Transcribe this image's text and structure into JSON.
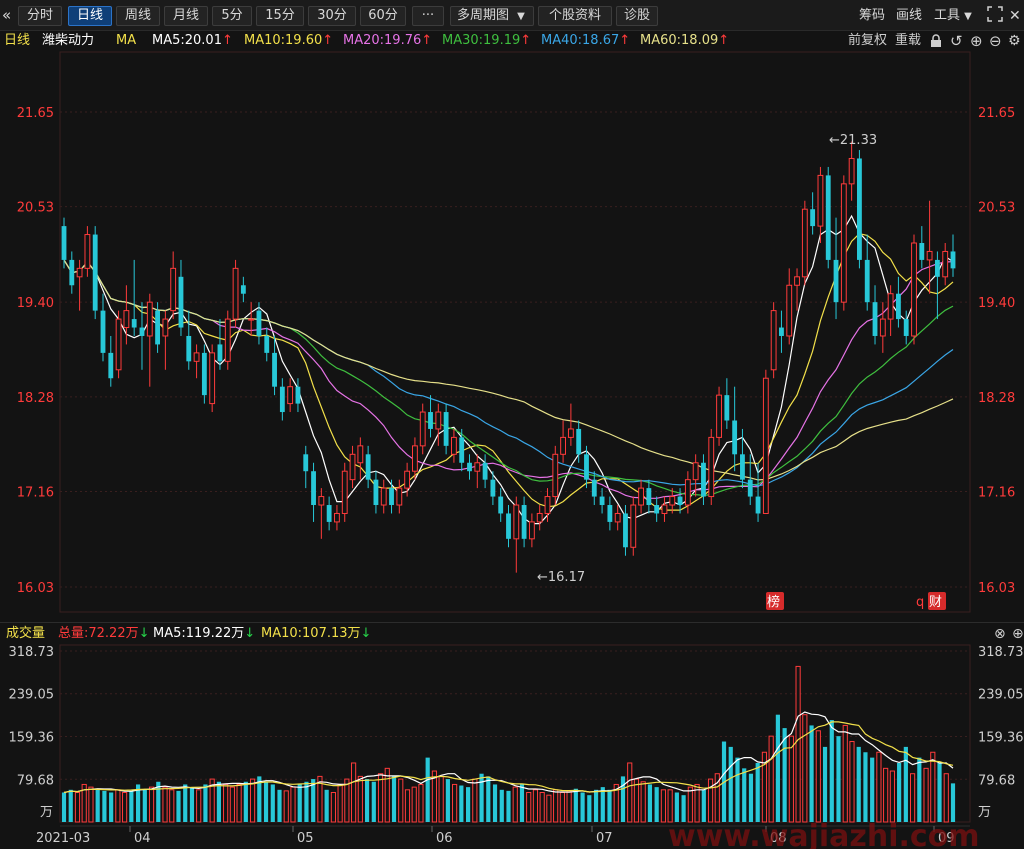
{
  "toolbar": {
    "back_icon": "double-chevron-left-icon",
    "buttons": [
      "分时",
      "日线",
      "周线",
      "月线",
      "5分",
      "15分",
      "30分",
      "60分",
      "···",
      "多周期图",
      "个股资料",
      "诊股"
    ],
    "active": "日线",
    "multi_period_caret": "▼",
    "right_items": [
      "筹码",
      "画线",
      "工具"
    ],
    "tools_caret": "▼",
    "fullscreen_icon": "fullscreen-icon",
    "close_icon": "close-icon"
  },
  "ma_bar": {
    "period": "日线",
    "stock": "潍柴动力",
    "ma_label": "MA",
    "items": [
      {
        "text": "MA5:20.01",
        "arrow": "↑",
        "color": "#ffffff"
      },
      {
        "text": "MA10:19.60",
        "arrow": "↑",
        "color": "#f2e04a"
      },
      {
        "text": "MA20:19.76",
        "arrow": "↑",
        "color": "#e673e6"
      },
      {
        "text": "MA30:19.19",
        "arrow": "↑",
        "color": "#3fbf3f"
      },
      {
        "text": "MA40:18.67",
        "arrow": "↑",
        "color": "#3aa6e6"
      },
      {
        "text": "MA60:18.09",
        "arrow": "↑",
        "color": "#e6e08a"
      }
    ],
    "right": {
      "adjust": "前复权",
      "reset": "重载"
    },
    "icons": [
      "lock-icon",
      "undo-icon",
      "zoom-in-icon",
      "zoom-out-icon",
      "settings-icon"
    ]
  },
  "price_axis": {
    "ticks": [
      "21.65",
      "20.53",
      "19.40",
      "18.28",
      "17.16",
      "16.03"
    ],
    "high_annotation": "←21.33",
    "low_annotation": "←16.17",
    "badges": [
      "榜",
      "财"
    ],
    "marker": "q"
  },
  "volume_bar": {
    "title": "成交量",
    "total": "总量:72.22万",
    "total_arrow": "↓",
    "ma5": "MA5:119.22万",
    "ma5_arrow": "↓",
    "ma10": "MA10:107.13万",
    "ma10_arrow": "↓",
    "icons": [
      "close-circle-icon",
      "add-circle-icon"
    ]
  },
  "volume_axis": {
    "ticks": [
      "318.73",
      "239.05",
      "159.36",
      "79.68"
    ],
    "unit": "万"
  },
  "date_axis": [
    "2021-03",
    "04",
    "05",
    "06",
    "07",
    "08",
    "09"
  ],
  "watermark": "www.wajiazhi.com",
  "colors": {
    "up": "#ff3b3b",
    "down": "#28c8d8",
    "bg": "#131313",
    "grid": "#3a1f1f"
  },
  "chart_data": {
    "type": "candlestick",
    "candles": [
      [
        20.3,
        20.4,
        19.8,
        19.9
      ],
      [
        19.9,
        20.0,
        19.5,
        19.6
      ],
      [
        19.7,
        19.9,
        19.3,
        19.8
      ],
      [
        19.8,
        20.3,
        19.7,
        20.2
      ],
      [
        20.2,
        20.3,
        19.2,
        19.3
      ],
      [
        19.3,
        19.5,
        18.7,
        18.8
      ],
      [
        18.8,
        19.0,
        18.4,
        18.5
      ],
      [
        18.6,
        19.3,
        18.5,
        19.2
      ],
      [
        19.1,
        19.6,
        18.9,
        19.3
      ],
      [
        19.2,
        19.9,
        19.0,
        19.1
      ],
      [
        19.1,
        19.4,
        18.6,
        19.0
      ],
      [
        19.0,
        19.5,
        18.4,
        19.4
      ],
      [
        19.3,
        19.4,
        18.8,
        18.9
      ],
      [
        19.0,
        19.3,
        18.6,
        19.2
      ],
      [
        19.3,
        20.0,
        19.2,
        19.8
      ],
      [
        19.7,
        19.9,
        19.0,
        19.1
      ],
      [
        19.0,
        19.3,
        18.6,
        18.7
      ],
      [
        18.7,
        18.9,
        18.5,
        18.8
      ],
      [
        18.8,
        18.9,
        18.2,
        18.3
      ],
      [
        18.2,
        18.9,
        18.1,
        18.8
      ],
      [
        18.9,
        19.2,
        18.6,
        18.7
      ],
      [
        18.7,
        19.3,
        18.6,
        19.2
      ],
      [
        19.2,
        19.9,
        19.1,
        19.8
      ],
      [
        19.6,
        19.7,
        19.4,
        19.5
      ],
      [
        19.2,
        19.4,
        19.0,
        19.2
      ],
      [
        19.3,
        19.4,
        18.9,
        19.0
      ],
      [
        19.0,
        19.1,
        18.7,
        18.8
      ],
      [
        18.8,
        19.0,
        18.3,
        18.4
      ],
      [
        18.4,
        18.5,
        18.0,
        18.1
      ],
      [
        18.2,
        18.5,
        18.1,
        18.4
      ],
      [
        18.4,
        18.5,
        18.1,
        18.2
      ],
      [
        17.6,
        17.7,
        17.2,
        17.4
      ],
      [
        17.4,
        17.5,
        16.8,
        17.0
      ],
      [
        17.0,
        17.2,
        16.6,
        17.1
      ],
      [
        17.0,
        17.1,
        16.7,
        16.8
      ],
      [
        16.8,
        17.0,
        16.7,
        16.9
      ],
      [
        16.9,
        17.5,
        16.8,
        17.4
      ],
      [
        17.3,
        17.7,
        17.2,
        17.6
      ],
      [
        17.5,
        17.8,
        17.3,
        17.7
      ],
      [
        17.6,
        17.7,
        17.2,
        17.3
      ],
      [
        17.3,
        17.4,
        16.9,
        17.0
      ],
      [
        17.0,
        17.3,
        16.9,
        17.2
      ],
      [
        17.2,
        17.3,
        16.9,
        17.0
      ],
      [
        17.0,
        17.3,
        16.9,
        17.2
      ],
      [
        17.2,
        17.5,
        17.1,
        17.4
      ],
      [
        17.4,
        17.8,
        17.3,
        17.7
      ],
      [
        17.7,
        18.2,
        17.6,
        18.1
      ],
      [
        18.1,
        18.3,
        17.8,
        17.9
      ],
      [
        17.9,
        18.2,
        17.7,
        18.1
      ],
      [
        18.1,
        18.2,
        17.6,
        17.7
      ],
      [
        17.6,
        17.9,
        17.5,
        17.8
      ],
      [
        17.8,
        17.9,
        17.4,
        17.5
      ],
      [
        17.5,
        17.6,
        17.3,
        17.4
      ],
      [
        17.4,
        17.6,
        17.2,
        17.5
      ],
      [
        17.5,
        17.6,
        17.2,
        17.3
      ],
      [
        17.3,
        17.4,
        17.0,
        17.1
      ],
      [
        17.1,
        17.2,
        16.8,
        16.9
      ],
      [
        16.9,
        17.0,
        16.5,
        16.6
      ],
      [
        16.6,
        17.1,
        16.2,
        17.0
      ],
      [
        17.0,
        17.1,
        16.5,
        16.6
      ],
      [
        16.6,
        16.9,
        16.5,
        16.8
      ],
      [
        16.8,
        17.0,
        16.7,
        16.9
      ],
      [
        16.9,
        17.2,
        16.8,
        17.1
      ],
      [
        17.1,
        17.7,
        17.0,
        17.6
      ],
      [
        17.6,
        18.0,
        17.5,
        17.8
      ],
      [
        17.8,
        18.2,
        17.7,
        17.9
      ],
      [
        17.9,
        18.0,
        17.5,
        17.6
      ],
      [
        17.6,
        17.7,
        17.2,
        17.3
      ],
      [
        17.3,
        17.4,
        17.0,
        17.1
      ],
      [
        17.1,
        17.2,
        16.9,
        17.0
      ],
      [
        17.0,
        17.1,
        16.7,
        16.8
      ],
      [
        16.8,
        17.0,
        16.7,
        16.9
      ],
      [
        16.9,
        17.0,
        16.4,
        16.5
      ],
      [
        16.5,
        17.1,
        16.4,
        17.0
      ],
      [
        17.0,
        17.3,
        16.9,
        17.2
      ],
      [
        17.2,
        17.3,
        16.9,
        17.0
      ],
      [
        17.0,
        17.1,
        16.8,
        16.9
      ],
      [
        16.9,
        17.1,
        16.8,
        17.0
      ],
      [
        17.0,
        17.2,
        16.9,
        17.1
      ],
      [
        17.1,
        17.2,
        16.9,
        17.0
      ],
      [
        17.0,
        17.4,
        16.9,
        17.3
      ],
      [
        17.3,
        17.6,
        17.1,
        17.5
      ],
      [
        17.5,
        17.6,
        17.0,
        17.1
      ],
      [
        17.1,
        17.9,
        17.0,
        17.8
      ],
      [
        17.8,
        18.4,
        17.7,
        18.3
      ],
      [
        18.3,
        18.5,
        17.9,
        18.0
      ],
      [
        18.0,
        18.4,
        17.4,
        17.6
      ],
      [
        17.6,
        17.9,
        17.2,
        17.3
      ],
      [
        17.3,
        17.6,
        17.0,
        17.1
      ],
      [
        17.1,
        17.5,
        16.8,
        16.9
      ],
      [
        16.9,
        18.6,
        16.9,
        18.5
      ],
      [
        18.6,
        19.4,
        18.5,
        19.3
      ],
      [
        19.1,
        19.3,
        18.8,
        19.0
      ],
      [
        19.0,
        19.8,
        18.9,
        19.6
      ],
      [
        19.6,
        19.8,
        19.3,
        19.7
      ],
      [
        19.7,
        20.6,
        19.6,
        20.5
      ],
      [
        20.5,
        20.7,
        20.2,
        20.3
      ],
      [
        20.3,
        21.0,
        20.1,
        20.9
      ],
      [
        20.9,
        21.0,
        19.8,
        19.9
      ],
      [
        19.9,
        20.4,
        19.2,
        19.4
      ],
      [
        19.4,
        20.9,
        19.3,
        20.8
      ],
      [
        20.8,
        21.3,
        20.6,
        21.1
      ],
      [
        21.1,
        21.2,
        19.8,
        19.9
      ],
      [
        19.9,
        20.2,
        19.3,
        19.4
      ],
      [
        19.4,
        19.6,
        18.9,
        19.0
      ],
      [
        19.0,
        19.4,
        18.8,
        19.2
      ],
      [
        19.2,
        19.6,
        19.0,
        19.5
      ],
      [
        19.5,
        19.7,
        19.1,
        19.2
      ],
      [
        19.2,
        19.3,
        18.9,
        19.0
      ],
      [
        19.0,
        20.2,
        18.9,
        20.1
      ],
      [
        20.1,
        20.3,
        19.8,
        19.9
      ],
      [
        19.9,
        20.6,
        19.5,
        20.0
      ],
      [
        19.9,
        20.0,
        19.2,
        19.7
      ],
      [
        19.7,
        20.1,
        19.6,
        20.0
      ],
      [
        20.0,
        20.2,
        19.7,
        19.8
      ]
    ],
    "volumes": [
      55,
      60,
      55,
      70,
      65,
      60,
      58,
      55,
      60,
      55,
      58,
      70,
      60,
      65,
      75,
      65,
      60,
      58,
      70,
      65,
      60,
      70,
      80,
      75,
      70,
      65,
      70,
      75,
      80,
      85,
      75,
      70,
      60,
      58,
      65,
      70,
      75,
      80,
      85,
      60,
      55,
      70,
      80,
      110,
      85,
      80,
      75,
      90,
      100,
      85,
      80,
      60,
      65,
      70,
      120,
      95,
      85,
      80,
      70,
      68,
      65,
      80,
      90,
      85,
      70,
      60,
      58,
      65,
      70,
      55,
      60,
      55,
      50,
      60,
      55,
      58,
      62,
      55,
      50,
      60,
      65,
      60,
      70,
      85,
      110,
      80,
      75,
      70,
      65,
      60,
      60,
      55,
      50,
      65,
      70,
      60,
      80,
      90,
      150,
      140,
      120,
      100,
      90,
      110,
      130,
      160,
      200,
      175,
      160,
      290,
      200,
      180,
      170,
      140,
      190,
      160,
      180,
      150,
      140,
      130,
      120,
      130,
      100,
      95,
      110,
      140,
      90,
      120,
      100,
      130,
      110,
      90,
      72
    ],
    "price_ylim": [
      16.03,
      21.65
    ],
    "volume_ylim": [
      0,
      318.73
    ],
    "annotations": {
      "high": "21.33",
      "low": "16.17"
    }
  }
}
